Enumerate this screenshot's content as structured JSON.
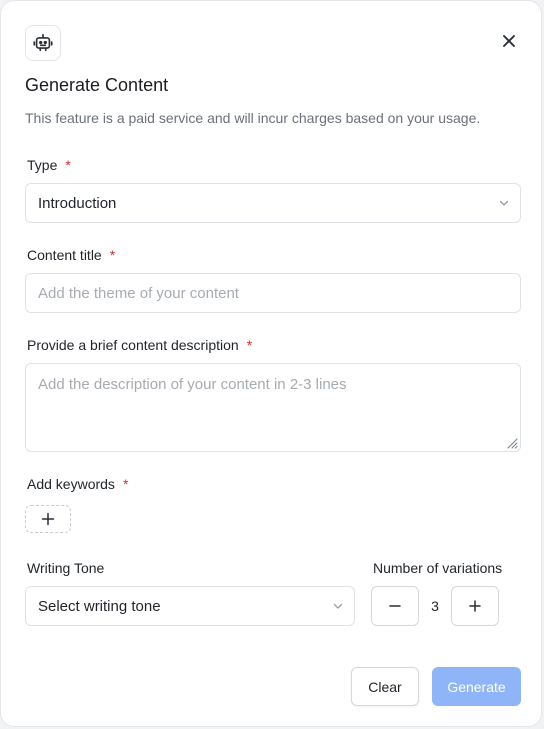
{
  "dialog": {
    "title": "Generate Content",
    "subtitle": "This feature is a paid service and will incur charges based on your usage.",
    "icons": {
      "badge": "robot-icon",
      "close": "close-icon"
    }
  },
  "type_field": {
    "label": "Type",
    "required_mark": "*",
    "value": "Introduction"
  },
  "content_title": {
    "label": "Content title",
    "required_mark": "*",
    "placeholder": "Add the theme of your content"
  },
  "description": {
    "label": "Provide a brief content description",
    "required_mark": "*",
    "placeholder": "Add the description of your content in 2-3 lines"
  },
  "keywords": {
    "label": "Add keywords",
    "required_mark": "*"
  },
  "writing_tone": {
    "label": "Writing Tone",
    "placeholder": "Select writing tone"
  },
  "variations": {
    "label": "Number of variations",
    "value": "3"
  },
  "actions": {
    "clear_label": "Clear",
    "generate_label": "Generate"
  },
  "colors": {
    "accent": "#8fb4f8",
    "required": "#d92d2d"
  }
}
